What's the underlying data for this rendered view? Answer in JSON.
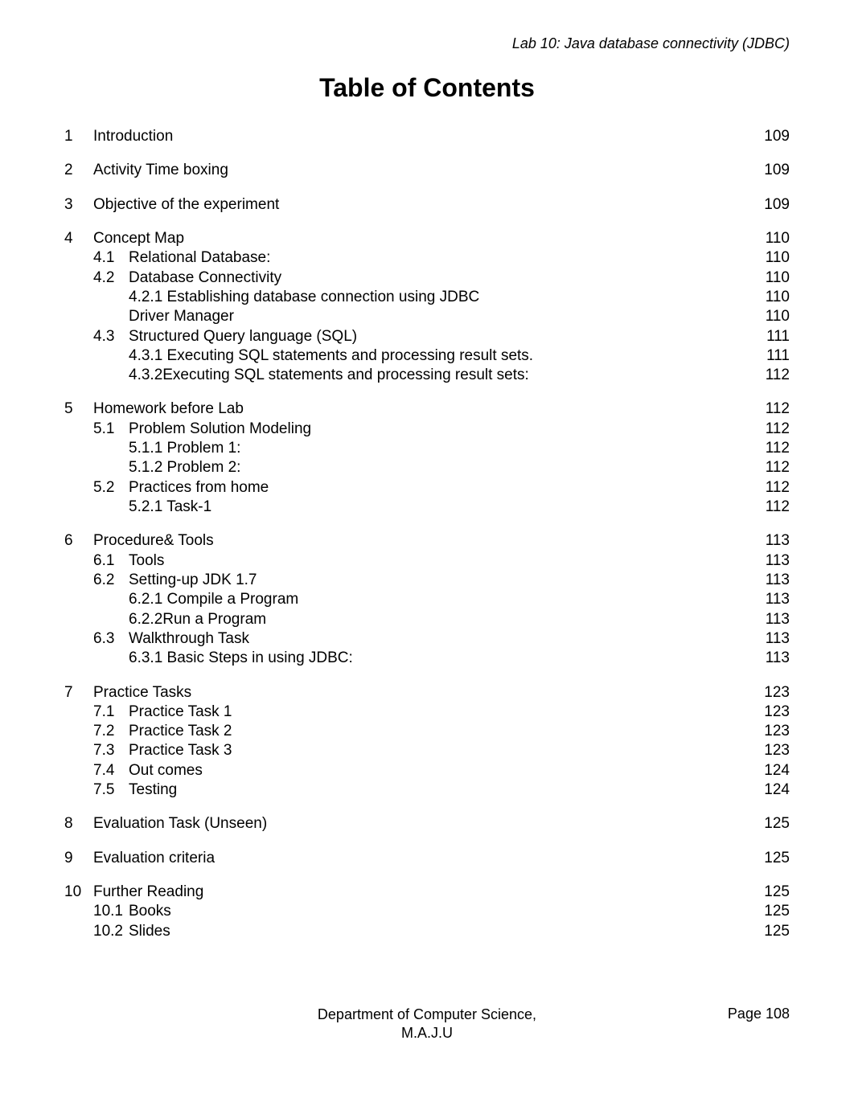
{
  "header": {
    "running": "Lab 10: Java database connectivity (JDBC)"
  },
  "title": "Table of Contents",
  "toc": [
    {
      "num": 1,
      "title": "Introduction",
      "page": 109
    },
    {
      "num": 2,
      "title": "Activity Time boxing",
      "page": 109
    },
    {
      "num": 3,
      "title": "Objective of the experiment",
      "page": 109
    },
    {
      "num": 4,
      "title": "Concept Map",
      "page": 110,
      "subs": [
        {
          "num": "4.1",
          "title": "Relational Database:",
          "page": 110
        },
        {
          "num": "4.2",
          "title": "Database Connectivity",
          "page": 110,
          "subs": [
            {
              "num": "4.2.1",
              "title": "Establishing database connection using JDBC Driver Manager",
              "display_lines": [
                {
                  "text": "4.2.1 Establishing database connection using JDBC",
                  "page": 110
                },
                {
                  "text": "Driver Manager",
                  "page": 110
                }
              ]
            }
          ]
        },
        {
          "num": "4.3",
          "title": "Structured Query language (SQL)",
          "page": 111,
          "subs": [
            {
              "num": "4.3.1",
              "title": "Executing SQL statements and processing result sets.",
              "display_lines": [
                {
                  "text": "4.3.1 Executing SQL statements and processing result sets.",
                  "page": 111
                }
              ]
            },
            {
              "num": "4.3.2",
              "title": "Executing SQL statements and processing result sets:",
              "display_lines": [
                {
                  "text": "4.3.2Executing SQL statements and processing result sets:",
                  "page": 112
                }
              ]
            }
          ]
        }
      ]
    },
    {
      "num": 5,
      "title": "Homework before Lab",
      "page": 112,
      "subs": [
        {
          "num": "5.1",
          "title": "Problem Solution Modeling",
          "page": 112,
          "subs": [
            {
              "num": "5.1.1",
              "title": "Problem 1:",
              "page": 112,
              "display_lines": [
                {
                  "text": "5.1.1  Problem 1:",
                  "page": 112
                }
              ]
            },
            {
              "num": "5.1.2",
              "title": "Problem 2:",
              "page": 112,
              "display_lines": [
                {
                  "text": "5.1.2 Problem 2:",
                  "page": 112
                }
              ]
            }
          ]
        },
        {
          "num": "5.2",
          "title": "Practices from home",
          "page": 112,
          "subs": [
            {
              "num": "5.2.1",
              "title": "Task-1",
              "page": 112,
              "display_lines": [
                {
                  "text": "5.2.1 Task-1",
                  "page": 112
                }
              ]
            }
          ]
        }
      ]
    },
    {
      "num": 6,
      "title": "Procedure& Tools",
      "page": 113,
      "subs": [
        {
          "num": "6.1",
          "title": "Tools",
          "page": 113
        },
        {
          "num": "6.2",
          "title": "Setting-up JDK 1.7",
          "page": 113,
          "subs": [
            {
              "num": "6.2.1",
              "title": "Compile a Program",
              "page": 113,
              "display_lines": [
                {
                  "text": "6.2.1 Compile a Program",
                  "page": 113
                }
              ]
            },
            {
              "num": "6.2.2",
              "title": "Run a Program",
              "page": 113,
              "display_lines": [
                {
                  "text": "6.2.2Run a Program",
                  "page": 113
                }
              ]
            }
          ]
        },
        {
          "num": "6.3",
          "title": "Walkthrough Task",
          "page": 113,
          "subs": [
            {
              "num": "6.3.1",
              "title": "Basic Steps in using JDBC:",
              "page": 113,
              "display_lines": [
                {
                  "text": "6.3.1 Basic Steps in using JDBC:",
                  "page": 113
                }
              ]
            }
          ]
        }
      ]
    },
    {
      "num": 7,
      "title": "Practice Tasks",
      "page": 123,
      "subs": [
        {
          "num": "7.1",
          "title": "Practice Task 1",
          "page": 123
        },
        {
          "num": "7.2",
          "title": "Practice Task 2",
          "page": 123
        },
        {
          "num": "7.3",
          "title": "Practice Task 3",
          "page": 123
        },
        {
          "num": "7.4",
          "title": "Out comes",
          "page": 124
        },
        {
          "num": "7.5",
          "title": "Testing",
          "page": 124
        }
      ]
    },
    {
      "num": 8,
      "title": "Evaluation Task (Unseen)",
      "page": 125
    },
    {
      "num": 9,
      "title": "Evaluation criteria",
      "page": 125
    },
    {
      "num": 10,
      "title": "Further Reading",
      "page": 125,
      "subs": [
        {
          "num": "10.1",
          "title": "Books",
          "page": 125
        },
        {
          "num": "10.2",
          "title": "Slides",
          "page": 125
        }
      ]
    }
  ],
  "footer": {
    "dept_line1": "Department of Computer Science,",
    "dept_line2": "M.A.J.U",
    "page_label": "Page 108"
  }
}
